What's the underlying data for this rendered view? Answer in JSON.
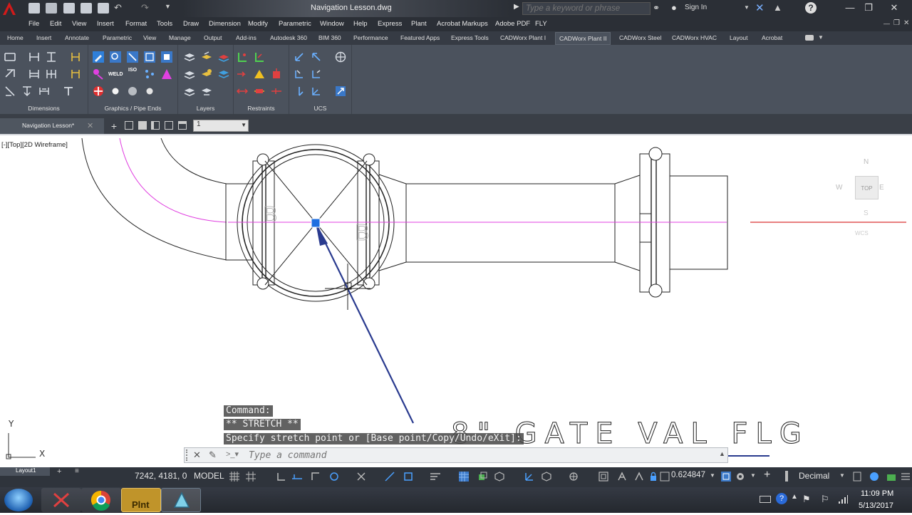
{
  "window": {
    "title": "Navigation Lesson.dwg",
    "search_placeholder": "Type a keyword or phrase",
    "signin_label": "Sign In"
  },
  "menu": [
    "File",
    "Edit",
    "View",
    "Insert",
    "Format",
    "Tools",
    "Draw",
    "Dimension",
    "Modify",
    "Parametric",
    "Window",
    "Help",
    "Express",
    "Plant",
    "Acrobat Markups",
    "Adobe PDF",
    "FLY"
  ],
  "ribbon_tabs": [
    "Home",
    "Insert",
    "Annotate",
    "Parametric",
    "View",
    "Manage",
    "Output",
    "Add-ins",
    "Autodesk 360",
    "BIM 360",
    "Performance",
    "Featured Apps",
    "Express Tools",
    "CADWorx Plant I",
    "CADWorx Plant II",
    "CADWorx Steel",
    "CADWorx HVAC",
    "Layout",
    "Acrobat"
  ],
  "active_ribbon_tab": "CADWorx Plant II",
  "ribbon_panels": [
    "Dimensions",
    "Graphics / Pipe Ends",
    "Layers",
    "Restraints",
    "UCS"
  ],
  "ribbon_icon_text": {
    "weld": "WELD",
    "iso": "ISO"
  },
  "file_tab": {
    "label": "Navigation Lesson*"
  },
  "layer_combo": {
    "value": "1"
  },
  "viewport": {
    "label": "[-][Top][2D Wireframe]"
  },
  "viewcube": {
    "top": "TOP",
    "north": "N",
    "west": "W",
    "east": "E",
    "south": "S",
    "wcs": "WCS"
  },
  "drawing": {
    "annotation_text": "8\" GATE VAL FLG",
    "valve_letters": [
      "B",
      "B"
    ]
  },
  "ucs": {
    "x": "X",
    "y": "Y"
  },
  "command": {
    "history": [
      "Command:",
      "** STRETCH **",
      "Specify stretch point or [Base point/Copy/Undo/eXit]:"
    ],
    "placeholder": "Type a command"
  },
  "statusbar": {
    "layout_tab": "Layout1",
    "coords": "7242, 4181, 0",
    "model": "MODEL",
    "scale": "0.624847",
    "units": "Decimal"
  },
  "taskbar": {
    "time": "11:09 PM",
    "date": "5/13/2017",
    "plant_label": "Plnt"
  },
  "colors": {
    "accent": "#0078d7",
    "pipe_centerline": "#e040e0",
    "ucs_red": "#d00000",
    "stretch_line": "#2a3b8f"
  }
}
